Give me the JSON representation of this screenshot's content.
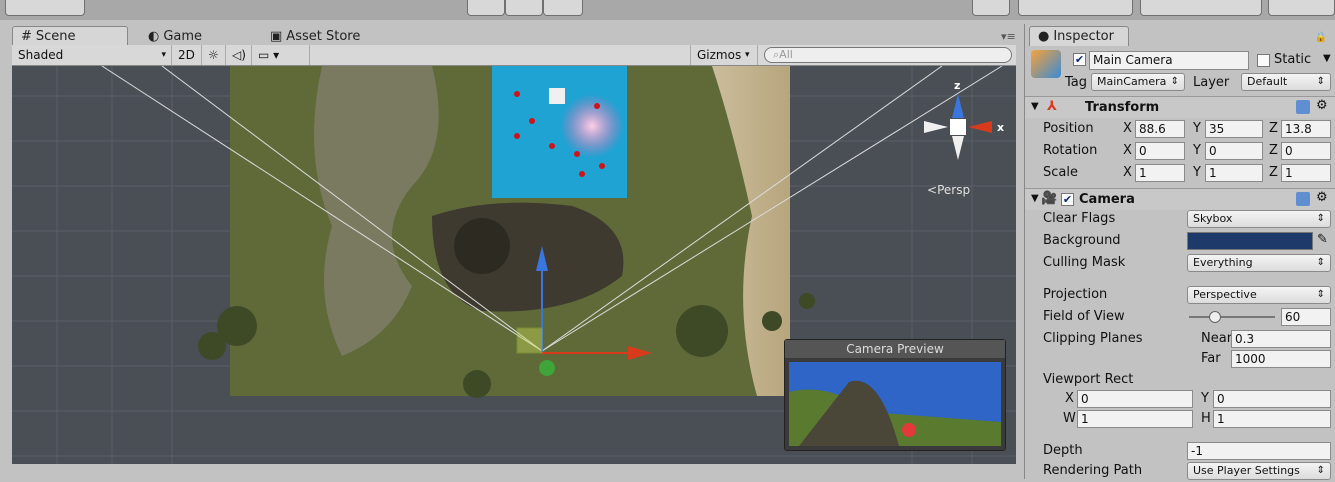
{
  "tabs": {
    "scene": "Scene",
    "game": "Game",
    "asset_store": "Asset Store"
  },
  "scene_toolbar": {
    "shading": "Shaded",
    "mode_2d": "2D",
    "gizmos": "Gizmos",
    "search_placeholder": "All"
  },
  "viewport": {
    "persp": "Persp",
    "axis_x": "x",
    "axis_z": "z",
    "camera_preview": "Camera Preview"
  },
  "inspector": {
    "tab": "Inspector",
    "object_name": "Main Camera",
    "static_label": "Static",
    "tag_label": "Tag",
    "tag_value": "MainCamera",
    "layer_label": "Layer",
    "layer_value": "Default",
    "transform": {
      "title": "Transform",
      "position": {
        "label": "Position",
        "x": "88.6",
        "y": "35",
        "z": "13.8"
      },
      "rotation": {
        "label": "Rotation",
        "x": "0",
        "y": "0",
        "z": "0"
      },
      "scale": {
        "label": "Scale",
        "x": "1",
        "y": "1",
        "z": "1"
      }
    },
    "camera": {
      "title": "Camera",
      "clear_flags": {
        "label": "Clear Flags",
        "value": "Skybox"
      },
      "background": {
        "label": "Background",
        "color": "#1e3a6a"
      },
      "culling_mask": {
        "label": "Culling Mask",
        "value": "Everything"
      },
      "projection": {
        "label": "Projection",
        "value": "Perspective"
      },
      "fov": {
        "label": "Field of View",
        "value": "60"
      },
      "clipping": {
        "label": "Clipping Planes",
        "near_label": "Near",
        "near": "0.3",
        "far_label": "Far",
        "far": "1000"
      },
      "viewport_rect": {
        "label": "Viewport Rect",
        "x": "0",
        "y": "0",
        "w": "1",
        "h": "1"
      },
      "depth": {
        "label": "Depth",
        "value": "-1"
      },
      "rendering_path": {
        "label": "Rendering Path",
        "value": "Use Player Settings"
      }
    },
    "axis": {
      "x": "X",
      "y": "Y",
      "z": "Z",
      "w": "W",
      "h": "H"
    }
  }
}
